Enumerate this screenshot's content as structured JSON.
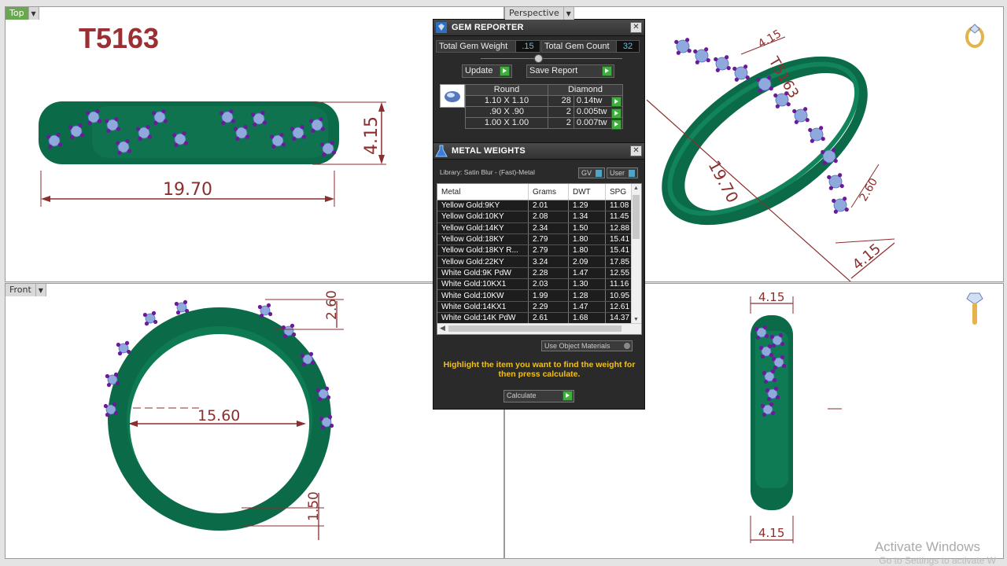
{
  "viewports": {
    "top": {
      "label": "Top",
      "model_title": "T5163",
      "dim_length": "19.70",
      "dim_height": "4.15"
    },
    "perspective": {
      "label": "Perspective",
      "dim_a": "4.15",
      "dim_b": "19.70",
      "dim_c": "2.60",
      "dim_d": "4.15",
      "dim_e": "T5163"
    },
    "front": {
      "label": "Front",
      "dim_inner": "15.60",
      "dim_top": "2.60",
      "dim_bottom": "1.50"
    },
    "right": {
      "dim_top": "4.15",
      "dim_bottom": "4.15"
    }
  },
  "gem_reporter": {
    "title": "GEM REPORTER",
    "total_weight_label": "Total Gem Weight",
    "total_weight_value": ".15",
    "total_count_label": "Total Gem Count",
    "total_count_value": "32",
    "update_label": "Update",
    "save_label": "Save Report",
    "table_head": [
      "Round",
      "Diamond"
    ],
    "rows": [
      {
        "size": "1.10 X 1.10",
        "count": "28",
        "tw": "0.14tw"
      },
      {
        "size": ".90 X .90",
        "count": "2",
        "tw": "0.005tw"
      },
      {
        "size": "1.00 X 1.00",
        "count": "2",
        "tw": "0.007tw"
      }
    ]
  },
  "metal_weights": {
    "title": "METAL WEIGHTS",
    "library": "Library: Satin Blur - (Fast)-Metal",
    "gv_label": "GV",
    "user_label": "User",
    "columns": [
      "Metal",
      "Grams",
      "DWT",
      "SPG"
    ],
    "rows": [
      {
        "metal": "Yellow Gold:9KY",
        "grams": "2.01",
        "dwt": "1.29",
        "spg": "11.08"
      },
      {
        "metal": "Yellow Gold:10KY",
        "grams": "2.08",
        "dwt": "1.34",
        "spg": "11.45"
      },
      {
        "metal": "Yellow Gold:14KY",
        "grams": "2.34",
        "dwt": "1.50",
        "spg": "12.88"
      },
      {
        "metal": "Yellow Gold:18KY",
        "grams": "2.79",
        "dwt": "1.80",
        "spg": "15.41"
      },
      {
        "metal": "Yellow Gold:18KY R...",
        "grams": "2.79",
        "dwt": "1.80",
        "spg": "15.41"
      },
      {
        "metal": "Yellow Gold:22KY",
        "grams": "3.24",
        "dwt": "2.09",
        "spg": "17.85"
      },
      {
        "metal": "White Gold:9K PdW",
        "grams": "2.28",
        "dwt": "1.47",
        "spg": "12.55"
      },
      {
        "metal": "White Gold:10KX1",
        "grams": "2.03",
        "dwt": "1.30",
        "spg": "11.16"
      },
      {
        "metal": "White Gold:10KW",
        "grams": "1.99",
        "dwt": "1.28",
        "spg": "10.95"
      },
      {
        "metal": "White Gold:14KX1",
        "grams": "2.29",
        "dwt": "1.47",
        "spg": "12.61"
      },
      {
        "metal": "White Gold:14K PdW",
        "grams": "2.61",
        "dwt": "1.68",
        "spg": "14.37"
      }
    ],
    "use_object_materials": "Use Object Materials",
    "note": "Highlight the item you want to find the weight for then press calculate.",
    "calculate_label": "Calculate"
  },
  "watermark": {
    "line1": "Activate Windows",
    "line2": "Go to Settings to activate W"
  },
  "colors": {
    "ring": "#0c6b4a",
    "gem": "#8fa9dd",
    "prong": "#6a1a9a",
    "dimension": "#8b2e2e",
    "accent": "#3fae3f"
  }
}
